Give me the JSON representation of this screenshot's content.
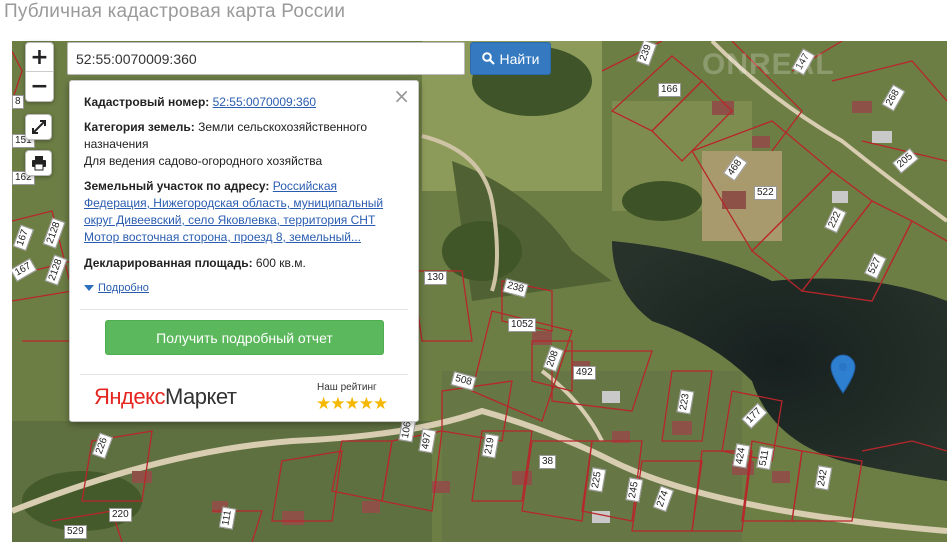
{
  "page": {
    "title": "Публичная кадастровая карта России"
  },
  "search": {
    "value": "52:55:0070009:360",
    "button_label": "Найти"
  },
  "zoom": {
    "in_label": "+",
    "out_label": "−"
  },
  "popup": {
    "cadastral_label": "Кадастровый номер:",
    "cadastral_number": "52:55:0070009:360",
    "category_label": "Категория земель:",
    "category_value": "Земли сельскохозяйственного назначения",
    "usage_value": "Для ведения садово-огородного хозяйства",
    "address_label": "Земельный участок по адресу:",
    "address_value": "Российская Федерация, Нижегородская область, муниципальный округ Дивеевский, село Яковлевка, территория СНТ Мотор восточная сторона, проезд 8, земельный...",
    "area_label": "Декларированная площадь:",
    "area_value": "600 кв.м.",
    "details_link": "Подробно",
    "report_button": "Получить подробный отчет",
    "market_logo_ya": "Яндекс",
    "market_logo_rest": "Маркет",
    "rating_label": "Наш рейтинг",
    "stars": "★★★★★"
  },
  "map": {
    "watermark": "ONREAL",
    "plot_labels": [
      "239",
      "166",
      "147",
      "268",
      "205",
      "468",
      "522",
      "222",
      "527",
      "130",
      "238",
      "1052",
      "208",
      "492",
      "508",
      "223",
      "177",
      "219",
      "424",
      "511",
      "242",
      "497",
      "38",
      "225",
      "245",
      "274",
      "226",
      "220",
      "529",
      "111",
      "106",
      "2128",
      "2128",
      "167",
      "167",
      "162",
      "151",
      "8"
    ]
  },
  "colors": {
    "accent": "#3579c1",
    "report": "#5cb85c",
    "pin": "#2f7fd1",
    "star": "#f5b800"
  }
}
